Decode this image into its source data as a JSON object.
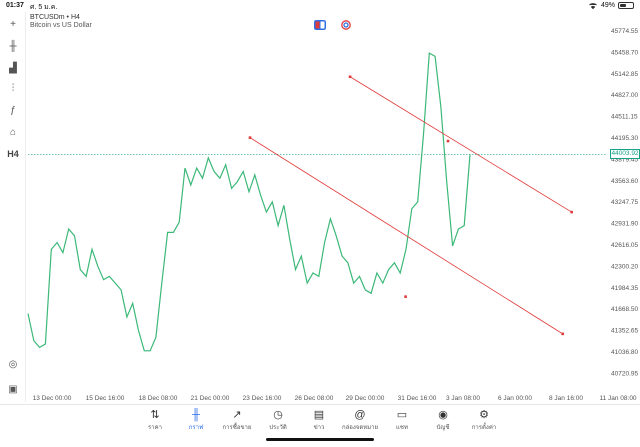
{
  "status": {
    "time": "01:37",
    "date": "ศ. 5 ม.ค.",
    "battery": "49%",
    "battery_level": 0.49
  },
  "symbol": {
    "name": "BTCUSDm • H4",
    "description": "Bitcoin vs US Dollar"
  },
  "left_tools": [
    {
      "icon": "crosshair-icon",
      "glyph": "+"
    },
    {
      "icon": "candlestick-icon",
      "glyph": "╫"
    },
    {
      "icon": "bar-chart-icon",
      "glyph": "▟"
    },
    {
      "icon": "indicators-icon",
      "glyph": "⫶"
    },
    {
      "icon": "function-icon",
      "glyph": "ƒ"
    },
    {
      "icon": "objects-icon",
      "glyph": "⌂"
    },
    {
      "icon": "timeframe",
      "glyph": "H4"
    }
  ],
  "price_axis": [
    "45774.55",
    "45458.70",
    "45142.85",
    "44827.00",
    "44511.15",
    "44195.30",
    "43879.45",
    "43563.60",
    "43247.75",
    "42931.90",
    "42616.05",
    "42300.20",
    "41984.35",
    "41668.50",
    "41352.65",
    "41036.80",
    "40720.95"
  ],
  "current_price": "44003.92",
  "time_axis": [
    "13 Dec 00:00",
    "15 Dec 16:00",
    "18 Dec 08:00",
    "21 Dec 00:00",
    "23 Dec 16:00",
    "26 Dec 08:00",
    "29 Dec 00:00",
    "31 Dec 16:00",
    "3 Jan 08:00",
    "6 Jan 00:00",
    "8 Jan 16:00",
    "11 Jan 08:00"
  ],
  "colors": {
    "line": "#3cb878",
    "trendline": "#e03a3a",
    "current_price": "#19a28a",
    "active_nav": "#2f6fe4"
  },
  "nav": [
    {
      "label": "ราคา",
      "icon": "quotes-icon",
      "glyph": "⇅",
      "active": false
    },
    {
      "label": "กราฟ",
      "icon": "chart-icon",
      "glyph": "╫",
      "active": true
    },
    {
      "label": "การซื้อขาย",
      "icon": "trade-icon",
      "glyph": "↗",
      "active": false
    },
    {
      "label": "ประวัติ",
      "icon": "history-icon",
      "glyph": "◷",
      "active": false
    },
    {
      "label": "ข่าว",
      "icon": "news-icon",
      "glyph": "▤",
      "active": false
    },
    {
      "label": "กล่องจดหมาย",
      "icon": "mailbox-icon",
      "glyph": "@",
      "active": false
    },
    {
      "label": "แชท",
      "icon": "chat-icon",
      "glyph": "▭",
      "active": false
    },
    {
      "label": "บัญชี",
      "icon": "account-icon",
      "glyph": "◉",
      "active": false
    },
    {
      "label": "การตั้งค่า",
      "icon": "settings-icon",
      "glyph": "⚙",
      "active": false
    }
  ],
  "chart_data": {
    "type": "line",
    "symbol": "BTCUSDm",
    "timeframe": "H4",
    "ylim": [
      40550,
      45900
    ],
    "grid": false,
    "y": [
      41650,
      41250,
      41150,
      41200,
      42600,
      42700,
      42550,
      42900,
      42800,
      42300,
      42200,
      42600,
      42350,
      42150,
      42200,
      42100,
      42000,
      41600,
      41800,
      41400,
      41100,
      41100,
      41300,
      42100,
      42850,
      42850,
      43000,
      43800,
      43550,
      43800,
      43650,
      43950,
      43750,
      43650,
      43850,
      43500,
      43600,
      43750,
      43450,
      43700,
      43400,
      43150,
      43300,
      42950,
      43250,
      42750,
      42300,
      42500,
      42100,
      42250,
      42200,
      42700,
      43050,
      42800,
      42500,
      42400,
      42100,
      42200,
      42000,
      41950,
      42250,
      42100,
      42300,
      42400,
      42250,
      42600,
      43200,
      43300,
      44300,
      45500,
      45450,
      44700,
      43600,
      42650,
      42900,
      42950,
      44000
    ],
    "trendlines": [
      {
        "x1": 0.225,
        "y1": 44250,
        "x2": 0.54,
        "y2": 41900,
        "x3": 0.973,
        "y3": 41350
      },
      {
        "x1": 0.322,
        "y1": 45150,
        "x2": 0.7,
        "y2": 44200,
        "x3": 0.99,
        "y3": 43150
      }
    ]
  }
}
